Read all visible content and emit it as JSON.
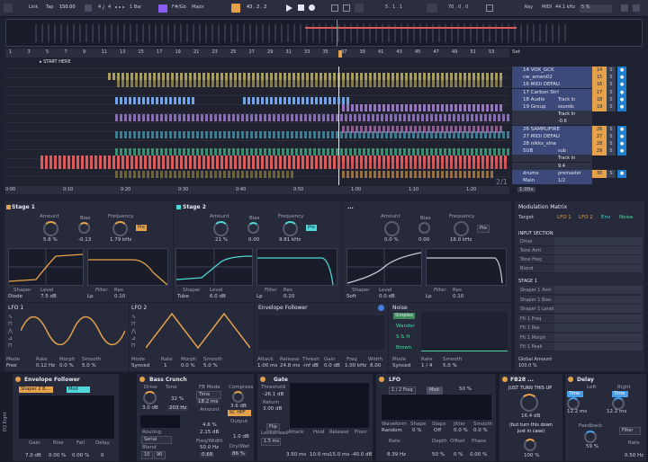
{
  "transport": {
    "link": "Link",
    "tap": "Tap",
    "tempo": "150.00",
    "sig_num": "4",
    "sig_den": "4",
    "quantize": "1 Bar",
    "key_root": "F#/Gb",
    "key_scale": "Major",
    "position": "43 . 2 . 2",
    "loop_start": "5 . 1 . 1",
    "loop_len": "70 . 0 . 0",
    "key_btn": "Key",
    "midi_btn": "MIDI",
    "sample_rate": "44.1 kHz",
    "cpu": "5 %"
  },
  "arrangement": {
    "start_marker": "START HERE",
    "set_label": "Set",
    "ruler_bars": [
      "1",
      "3",
      "5",
      "7",
      "9",
      "11",
      "13",
      "15",
      "17",
      "19",
      "21",
      "23",
      "25",
      "27",
      "29",
      "31",
      "33",
      "35",
      "37",
      "39",
      "41",
      "43",
      "45",
      "47",
      "49",
      "51",
      "53"
    ],
    "time_ruler": [
      "0:00",
      "0:10",
      "0:20",
      "0:30",
      "0:40",
      "0:50",
      "1:00",
      "1:10",
      "1:20",
      "1:30"
    ],
    "pagination": "2/1",
    "zoom": "1.00x"
  },
  "tracks": [
    {
      "name": "14 VOX_GCK",
      "num": "14",
      "color": "#e6a24a",
      "io": ""
    },
    {
      "name": "cw_amen02",
      "num": "15",
      "color": "#e6a24a",
      "io": ""
    },
    {
      "name": "16 MIDI DEFAU",
      "num": "16",
      "color": "#e6a24a",
      "io": ""
    },
    {
      "name": "17 Carbon Stri",
      "num": "17",
      "color": "#e6a24a",
      "io": ""
    },
    {
      "name": "18 Audio",
      "num": "18",
      "color": "#e6a24a",
      "io": "Track In"
    },
    {
      "name": "19 Group",
      "num": "19",
      "color": "#e6a24a",
      "io": "sounds"
    },
    {
      "name": "",
      "num": "",
      "color": "#e6a24a",
      "io": "Track In"
    },
    {
      "name": "",
      "num": "",
      "color": "#e6a24a",
      "io": "-0.6"
    },
    {
      "name": "26 SAMPLIFIRE",
      "num": "26",
      "color": "#e6a24a",
      "io": ""
    },
    {
      "name": "27 MIDI DEFAU",
      "num": "27",
      "color": "#e6a24a",
      "io": ""
    },
    {
      "name": "28 nikks_sine",
      "num": "28",
      "color": "#e6a24a",
      "io": ""
    },
    {
      "name": "SUB",
      "num": "29",
      "color": "#e6a24a",
      "io": "sub"
    },
    {
      "name": "",
      "num": "",
      "color": "#e6a24a",
      "io": "Track In"
    },
    {
      "name": "",
      "num": "",
      "color": "#e6a24a",
      "io": "9.4"
    },
    {
      "name": "drums",
      "num": "30",
      "color": "#e6a24a",
      "io": "premaster"
    },
    {
      "name": "Main",
      "num": "",
      "color": "#e6a24a",
      "io": "1/2"
    }
  ],
  "stage1": {
    "title": "Stage 1",
    "amount_lbl": "Amount",
    "amount": "5.6 %",
    "bias_lbl": "Bias",
    "bias": "-0.13",
    "freq_lbl": "Frequency",
    "freq": "1.79 kHz",
    "pre": "Pre",
    "shaper_lbl": "Shaper",
    "shaper": "Diode",
    "level_lbl": "Level",
    "level": "7.5 dB",
    "filter_lbl": "Filter",
    "filter": "Lp",
    "res_lbl": "Res",
    "res": "0.10"
  },
  "stage2": {
    "title": "Stage 2",
    "amount_lbl": "Amount",
    "amount": "21 %",
    "bias_lbl": "Bias",
    "bias": "0.00",
    "freq_lbl": "Frequency",
    "freq": "9.81 kHz",
    "pre": "Pre",
    "shaper_lbl": "Shaper",
    "shaper": "Tube",
    "level_lbl": "Level",
    "level": "6.0 dB",
    "filter_lbl": "Filter",
    "filter": "Lp",
    "res_lbl": "Res",
    "res": "0.10"
  },
  "stage3": {
    "title": "...",
    "amount_lbl": "Amount",
    "amount": "0.0 %",
    "bias_lbl": "Bias",
    "bias": "0.00",
    "freq_lbl": "Frequency",
    "freq": "16.0 kHz",
    "pre": "Pre",
    "shaper_lbl": "Shaper",
    "shaper": "Soft",
    "level_lbl": "Level",
    "level": "0.0 dB",
    "filter_lbl": "Filter",
    "filter": "Lp",
    "res_lbl": "Res",
    "res": "0.10"
  },
  "lfo1": {
    "title": "LFO 1",
    "mode_lbl": "Mode",
    "mode": "Free",
    "rate_lbl": "Rate",
    "rate": "0.12 Hz",
    "morph_lbl": "Morph",
    "morph": "0.0 %",
    "smooth_lbl": "Smooth",
    "smooth": "5.0 %"
  },
  "lfo2": {
    "title": "LFO 2",
    "mode_lbl": "Mode",
    "mode": "Synced",
    "rate_lbl": "Rate",
    "rate": "1",
    "morph_lbl": "Morph",
    "morph": "0.0 %",
    "smooth_lbl": "Smooth",
    "smooth": "5.0 %"
  },
  "envf": {
    "title": "Envelope Follower",
    "attack_lbl": "Attack",
    "attack": "1.00 ms",
    "release_lbl": "Release",
    "release": "24.8 ms",
    "thresh_lbl": "Thresh",
    "thresh": "-inf dB",
    "gain_lbl": "Gain",
    "gain": "0.0 dB",
    "freq_lbl": "Freq",
    "freq": "1.00 kHz",
    "width_lbl": "Width",
    "width": "8.00"
  },
  "noise": {
    "title": "Noise",
    "types": [
      "Simplex",
      "Wander",
      "S & H",
      "Brown"
    ],
    "mode_lbl": "Mode",
    "mode": "Synced",
    "rate_lbl": "Rate",
    "rate": "1 / 4",
    "smooth_lbl": "Smooth",
    "smooth": "5.0 %"
  },
  "modmatrix": {
    "title": "Modulation Matrix",
    "target_lbl": "Target",
    "cols": [
      "LFO 1",
      "LFO 2",
      "Env",
      "Noise"
    ],
    "input_section": "INPUT SECTION",
    "inputs": [
      "Drive",
      "Tone Amt",
      "Tone Freq",
      "Blend"
    ],
    "stage1_section": "STAGE 1",
    "stage1_rows": [
      "Shaper 1 Amt",
      "Shaper 1 Bias",
      "Shaper 1 Level",
      "Flt 1 Freq",
      "Flt 1 Res",
      "Flt 1 Morph",
      "Flt 1 Peak"
    ],
    "global_amount_lbl": "Global Amount",
    "global_amount": "100.0 %"
  },
  "devices": {
    "chain_label": "EQ Eight",
    "envf": {
      "title": "Envelope Follower",
      "preset": "Shaper 2 B...",
      "mod": "Mod",
      "gain_lbl": "Gain",
      "gain": "7.0 dB",
      "rise_lbl": "Rise",
      "rise": "0.00 %",
      "fall_lbl": "Fall",
      "fall": "0.00 %",
      "delay_lbl": "Delay",
      "delay": "0"
    },
    "bass": {
      "title": "Bass Crunch",
      "drive_lbl": "Drive",
      "drive": "3.0 dB",
      "tone_lbl": "Tone",
      "tone": "32 %",
      "tone2": "203 Hz",
      "routing_lbl": "Routing",
      "routing": "Serial",
      "blend_lbl": "Blend",
      "blend_a": "10",
      "blend_b": "90",
      "fb_lbl": "FB Mode",
      "fb": "Time",
      "time": "18.2 ms",
      "amount_lbl": "Amount",
      "amount": "4.6 %",
      "ms": "2.15 dB",
      "freqw_lbl": "Freq/Width",
      "freqw": "50.0 Hz",
      "freqw2": "0.68",
      "comp_lbl": "Compress",
      "comp": "3.6 dB",
      "comp_mode": "SC HPF",
      "output_lbl": "Output",
      "output": "1.0 dB",
      "drywet_lbl": "Dry/Wet",
      "drywet": "86 %"
    },
    "gate": {
      "title": "Gate",
      "thresh_lbl": "Threshold",
      "thresh": "-26.1 dB",
      "return_lbl": "Return",
      "return": "3.00 dB",
      "flip": "Flip",
      "look_lbl": "Lookahead",
      "look": "1.5 ms",
      "attack_lbl": "Attack",
      "attack": "3.50 ms",
      "hold_lbl": "Hold",
      "hold": "10.0 ms",
      "release_lbl": "Release",
      "release": "15.0 ms",
      "floor_lbl": "Floor",
      "floor": "-40.0 dB"
    },
    "lfo": {
      "title": "LFO",
      "rate_sel": "1 / 2 Freq",
      "mod": "Mod",
      "pct": "50 %",
      "wave_lbl": "Waveform",
      "wave": "Random",
      "shape_lbl": "Shape",
      "shape": "0 %",
      "steps_lbl": "Steps",
      "steps": "Off",
      "jitter_lbl": "Jitter",
      "jitter": "0.0 %",
      "smooth_lbl": "Smooth",
      "smooth": "0.0 %",
      "rate_lbl": "Rate",
      "rate": "8.39 Hz",
      "depth_lbl": "Depth",
      "depth": "50 %",
      "offset_lbl": "Offset",
      "offset": "0 %",
      "phase_lbl": "Phase",
      "phase": "0.00 %"
    },
    "fb": {
      "title": "FB28 ...",
      "turn": "JUST TURN THIS UP",
      "ms": "16.4 dB",
      "note": "(but turn this down just in case)",
      "pct": "100 %"
    },
    "delay": {
      "title": "Delay",
      "left_lbl": "Left",
      "right_lbl": "Right",
      "time_l": "Time",
      "time_r": "Time",
      "left": "12.2 ms",
      "right": "12.2 ms",
      "fb_lbl": "Feedback",
      "fb": "59 %",
      "filter": "Filter",
      "rate_lbl": "Rate",
      "rate": "0.50 Hz"
    }
  }
}
